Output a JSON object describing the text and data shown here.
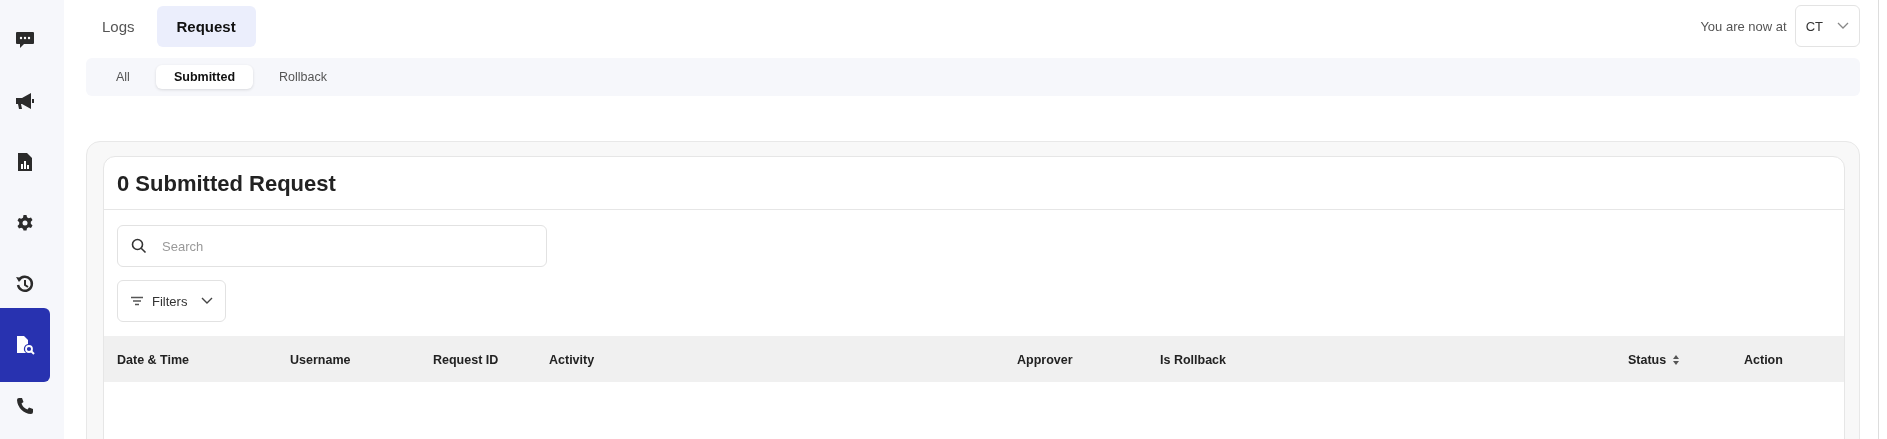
{
  "sidebar": {
    "items": [
      {
        "kind": "chat",
        "selected": false
      },
      {
        "kind": "megaphone",
        "selected": false
      },
      {
        "kind": "report",
        "selected": false
      },
      {
        "kind": "gear",
        "selected": false
      },
      {
        "kind": "history",
        "selected": false
      },
      {
        "kind": "filesearch",
        "selected": true
      },
      {
        "kind": "phone",
        "selected": false
      }
    ]
  },
  "tabs": [
    {
      "label": "Logs",
      "selected": false
    },
    {
      "label": "Request",
      "selected": true
    }
  ],
  "location": {
    "label": "You are now at",
    "value": "CT"
  },
  "subtabs": [
    {
      "label": "All",
      "selected": false
    },
    {
      "label": "Submitted",
      "selected": true
    },
    {
      "label": "Rollback",
      "selected": false
    }
  ],
  "card": {
    "title": "0 Submitted Request",
    "search": {
      "placeholder": "Search"
    },
    "filters": "Filters"
  },
  "table": {
    "columns": [
      {
        "label": "Date & Time",
        "sortable": false
      },
      {
        "label": "Username",
        "sortable": false
      },
      {
        "label": "Request ID",
        "sortable": false
      },
      {
        "label": "Activity",
        "sortable": false
      },
      {
        "label": "Approver",
        "sortable": false
      },
      {
        "label": "Is Rollback",
        "sortable": false
      },
      {
        "label": "Status",
        "sortable": true
      },
      {
        "label": "Action",
        "sortable": false
      }
    ]
  }
}
